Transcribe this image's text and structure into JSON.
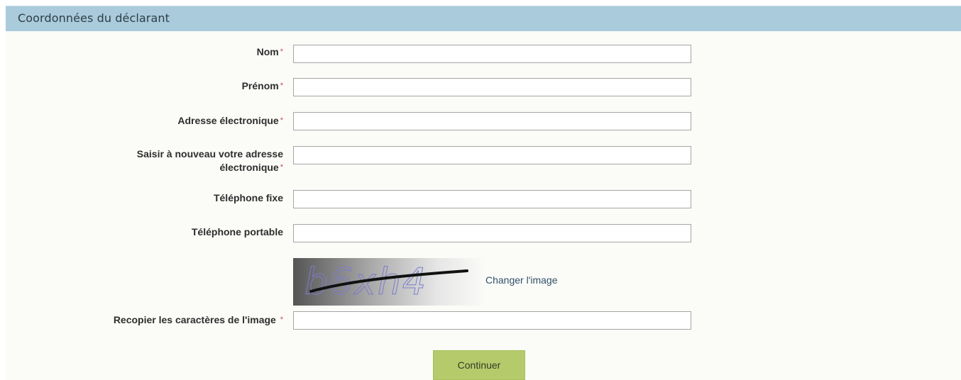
{
  "section": {
    "title": "Coordonnées du déclarant"
  },
  "form": {
    "required_mark": "*",
    "fields": [
      {
        "label": "Nom",
        "value": "",
        "required": true
      },
      {
        "label": "Prénom",
        "value": "",
        "required": true
      },
      {
        "label": "Adresse électronique",
        "value": "",
        "required": true
      },
      {
        "label_line1": "Saisir à nouveau votre adresse",
        "label_line2": "électronique",
        "value": "",
        "required": true
      },
      {
        "label": "Téléphone fixe",
        "value": "",
        "required": false
      },
      {
        "label": "Téléphone portable",
        "value": "",
        "required": false
      },
      {
        "label": "Recopier les caractères de l'image",
        "value": "",
        "required": true
      }
    ],
    "captcha": {
      "image_text": "b6xh4",
      "change_label": "Changer l'image"
    },
    "submit_label": "Continuer"
  },
  "colors": {
    "header_bg": "#a9cbdc",
    "required_star": "#c0504d",
    "button_bg": "#b5cb6b",
    "link": "#31506a"
  }
}
